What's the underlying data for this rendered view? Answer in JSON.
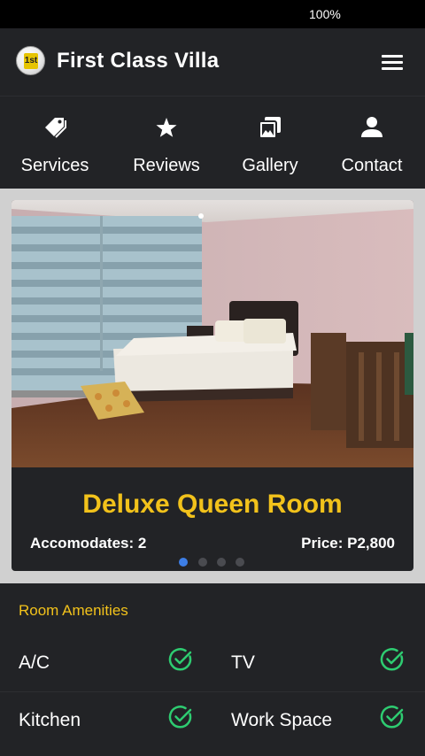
{
  "status_bar": {
    "battery": "100%"
  },
  "app_bar": {
    "title": "First Class Villa",
    "logo_text": "1st"
  },
  "tabs": [
    {
      "label": "Services",
      "icon": "tag-icon"
    },
    {
      "label": "Reviews",
      "icon": "star-icon"
    },
    {
      "label": "Gallery",
      "icon": "image-icon"
    },
    {
      "label": "Contact",
      "icon": "person-icon"
    }
  ],
  "room": {
    "name": "Deluxe Queen Room",
    "accommodates": "Accomodates: 2",
    "price": "Price: P2,800",
    "slide_count": 4,
    "active_slide": 1
  },
  "amenities": {
    "title": "Room Amenities",
    "items": [
      "A/C",
      "TV",
      "Kitchen",
      "Work Space"
    ]
  },
  "colors": {
    "accent": "#f2c21b",
    "check": "#2ecc71",
    "active_dot": "#3d7ee6",
    "background": "#222326"
  }
}
